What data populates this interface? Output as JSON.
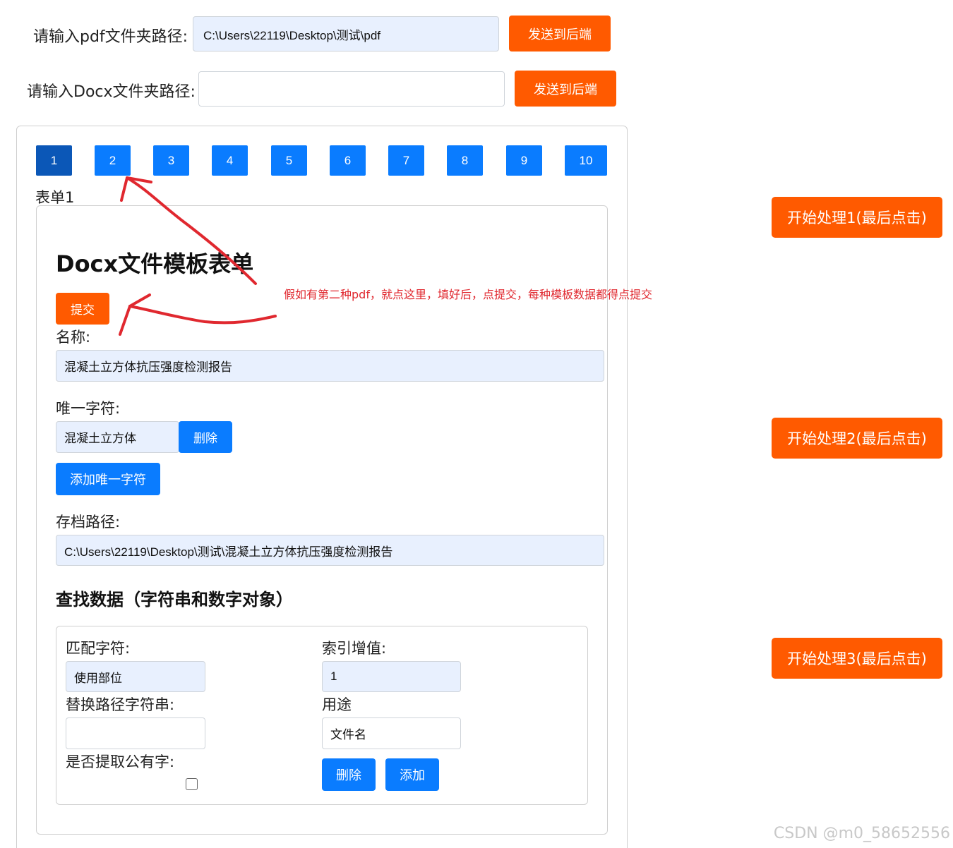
{
  "pdf_row": {
    "label": "请输入pdf文件夹路径:",
    "value": "C:\\Users\\22119\\Desktop\\测试\\pdf",
    "send_label": "发送到后端"
  },
  "docx_row": {
    "label": "请输入Docx文件夹路径:",
    "value": "",
    "send_label": "发送到后端"
  },
  "tabs": [
    "1",
    "2",
    "3",
    "4",
    "5",
    "6",
    "7",
    "8",
    "9",
    "10"
  ],
  "active_tab": "1",
  "form_title": "表单1",
  "form": {
    "heading": "Docx文件模板表单",
    "submit_label": "提交",
    "name_label": "名称:",
    "name_value": "混凝土立方体抗压强度检测报告",
    "unique_label": "唯一字符:",
    "unique_value": "混凝土立方体",
    "delete_label": "删除",
    "add_unique_label": "添加唯一字符",
    "archive_label": "存档路径:",
    "archive_value": "C:\\Users\\22119\\Desktop\\测试\\混凝土立方体抗压强度检测报告",
    "search_heading": "查找数据（字符串和数字对象）",
    "search": {
      "match_label": "匹配字符:",
      "match_value": "使用部位",
      "index_label": "索引增值:",
      "index_value": "1",
      "replace_label": "替换路径字符串:",
      "replace_value": "",
      "purpose_label": "用途",
      "purpose_value": "文件名",
      "extract_label": "是否提取公有字:",
      "extract_checked": false,
      "delete_label": "删除",
      "add_label": "添加"
    }
  },
  "side_buttons": [
    "开始处理1(最后点击)",
    "开始处理2(最后点击)",
    "开始处理3(最后点击)"
  ],
  "annotation": "假如有第二种pdf，就点这里，填好后，点提交，每种模板数据都得点提交",
  "watermark": "CSDN @m0_58652556",
  "colors": {
    "orange": "#ff5a00",
    "blue": "#0a7cff",
    "active_tab": "#0b57b7",
    "input_fill": "#e8f0fe",
    "annotation_red": "#e0282f"
  }
}
